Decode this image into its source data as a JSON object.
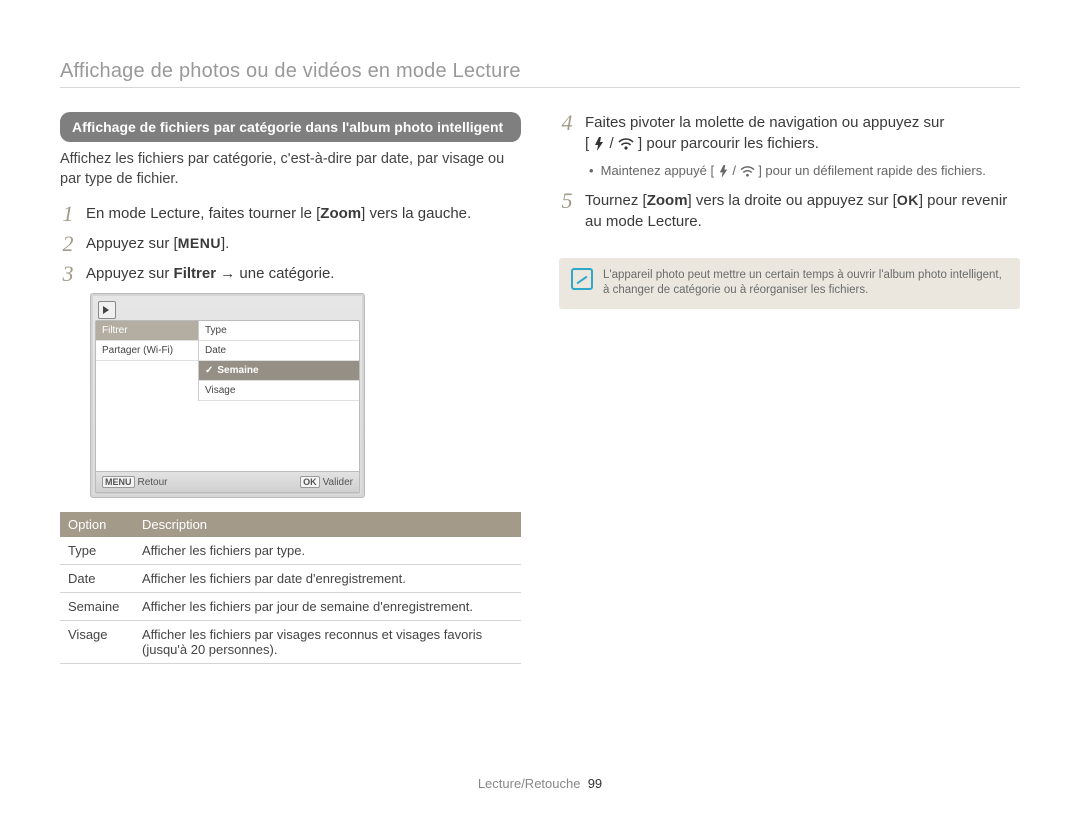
{
  "header": {
    "title": "Affichage de photos ou de vidéos en mode Lecture"
  },
  "section": {
    "heading": "Affichage de fichiers par catégorie dans l'album photo intelligent",
    "intro": "Affichez les fichiers par catégorie, c'est-à-dire par date, par visage ou par type de fichier."
  },
  "steps_left": [
    {
      "n": "1",
      "prefix": "En mode Lecture, faites tourner le [",
      "strong": "Zoom",
      "suffix": "] vers la gauche."
    },
    {
      "n": "2",
      "prefix": "Appuyez sur [",
      "kbd": "MENU",
      "suffix": "]."
    },
    {
      "n": "3",
      "prefix": "Appuyez sur ",
      "strong": "Filtrer",
      "mid": " →  une catégorie.",
      "suffix": ""
    }
  ],
  "device": {
    "left": [
      "Filtrer",
      "Partager (Wi-Fi)"
    ],
    "right": [
      "Type",
      "Date",
      "Semaine",
      "Visage"
    ],
    "right_selected_index": 2,
    "footer_left": "Retour",
    "footer_left_badge": "MENU",
    "footer_right": "Valider",
    "footer_right_badge": "OK"
  },
  "table": {
    "headers": [
      "Option",
      "Description"
    ],
    "rows": [
      [
        "Type",
        "Afficher les fichiers par type."
      ],
      [
        "Date",
        "Afficher les fichiers par date d'enregistrement."
      ],
      [
        "Semaine",
        "Afficher les fichiers par jour de semaine d'enregistrement."
      ],
      [
        "Visage",
        "Afficher les fichiers par visages reconnus et visages favoris (jusqu'à 20 personnes)."
      ]
    ]
  },
  "steps_right": [
    {
      "n": "4",
      "line1_pre": "Faites pivoter la molette de navigation ou appuyez sur",
      "line2_pre": "[",
      "icon_pair": "flash_wifi",
      "line2_post": "] pour parcourir les fichiers.",
      "bullet_pre": "Maintenez appuyé [",
      "bullet_post": "] pour un défilement rapide des fichiers."
    },
    {
      "n": "5",
      "pre": "Tournez [",
      "strong": "Zoom",
      "mid": "] vers la droite ou appuyez sur [",
      "kbd": "OK",
      "post": "] pour revenir au mode Lecture."
    }
  ],
  "note": {
    "text": "L'appareil photo peut mettre un certain temps à ouvrir l'album photo intelligent, à changer de catégorie ou à réorganiser les fichiers."
  },
  "footer": {
    "section": "Lecture/Retouche",
    "page": "99"
  }
}
